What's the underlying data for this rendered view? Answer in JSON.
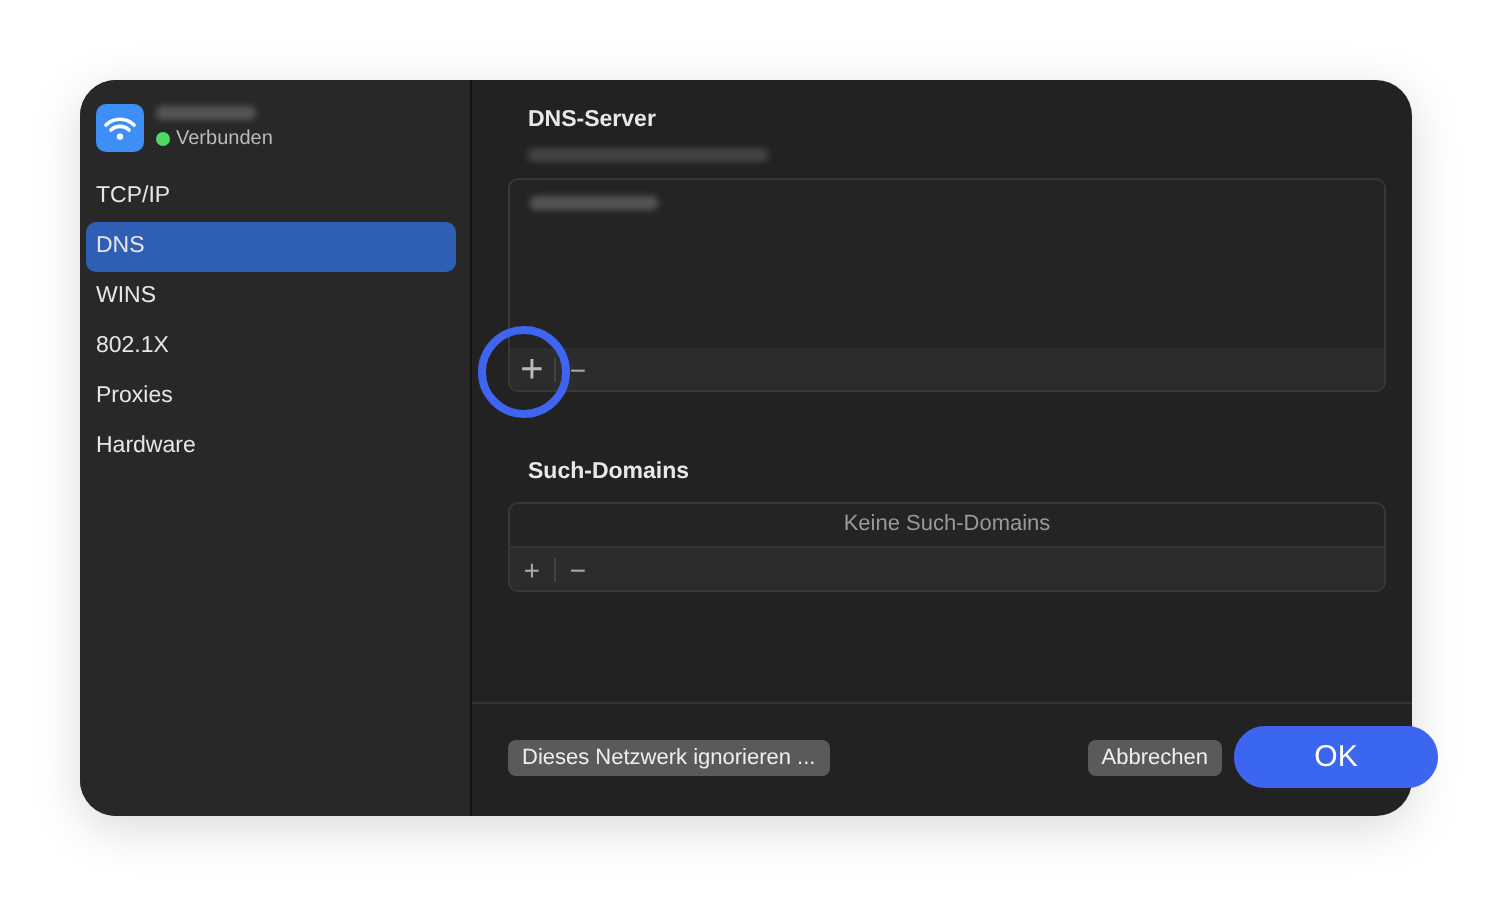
{
  "sidebar": {
    "connection": {
      "status": "Verbunden",
      "connected": true
    },
    "items": [
      {
        "label": "TCP/IP",
        "selected": false
      },
      {
        "label": "DNS",
        "selected": true
      },
      {
        "label": "WINS",
        "selected": false
      },
      {
        "label": "802.1X",
        "selected": false
      },
      {
        "label": "Proxies",
        "selected": false
      },
      {
        "label": "Hardware",
        "selected": false
      }
    ]
  },
  "dns_server": {
    "title": "DNS-Server",
    "add": "+",
    "remove": "−",
    "add_highlighted": true
  },
  "search_domains": {
    "title": "Such-Domains",
    "empty": "Keine Such-Domains",
    "add": "+",
    "remove": "−"
  },
  "buttons": {
    "ignore": "Dieses Netzwerk ignorieren ...",
    "cancel": "Abbrechen",
    "ok": "OK"
  }
}
